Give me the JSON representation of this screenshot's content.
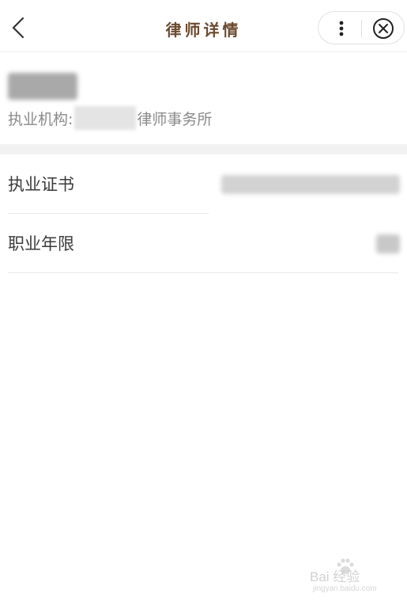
{
  "navbar": {
    "title": "律师详情",
    "icons": {
      "back": "chevron-left-icon",
      "more": "more-vertical-icon",
      "close": "close-circle-icon"
    },
    "title_color": "#6b4a2e"
  },
  "profile": {
    "org_label": "执业机构:",
    "org_suffix": "律师事务所"
  },
  "details": [
    {
      "label": "执业证书"
    },
    {
      "label": "职业年限"
    }
  ],
  "watermark": {
    "text": "Bai 经验",
    "sub": "jingyan.baidu.com"
  }
}
